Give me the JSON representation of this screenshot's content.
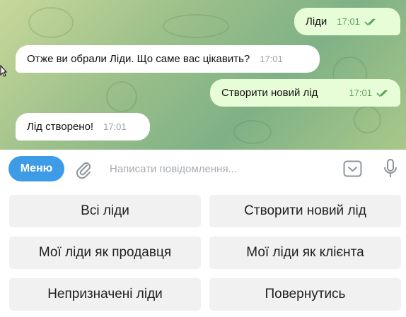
{
  "chat": {
    "messages": [
      {
        "direction": "out",
        "text": "Ліди",
        "time": "17:01",
        "read": true
      },
      {
        "direction": "in",
        "text": "Отже ви обрали Ліди. Що саме вас цікавить?",
        "time": "17:01"
      },
      {
        "direction": "out",
        "text": "Створити новий лід",
        "time": "17:01",
        "read": true
      },
      {
        "direction": "in",
        "text": "Лід створено!",
        "time": "17:01"
      }
    ]
  },
  "input_bar": {
    "menu_label": "Меню",
    "placeholder": "Написати повідомлення...",
    "icons": [
      "paperclip-icon",
      "keyboard-toggle-icon",
      "microphone-icon"
    ]
  },
  "keyboard": {
    "rows": [
      [
        "Всі ліди",
        "Створити новий лід"
      ],
      [
        "Мої ліди як продавця",
        "Мої ліди як клієнта"
      ],
      [
        "Непризначені ліди",
        "Повернутись"
      ]
    ]
  },
  "colors": {
    "accent": "#3e9be6",
    "outgoing_bubble": "#e7fdd7",
    "incoming_bubble": "#ffffff",
    "read_check": "#5fa25b"
  }
}
